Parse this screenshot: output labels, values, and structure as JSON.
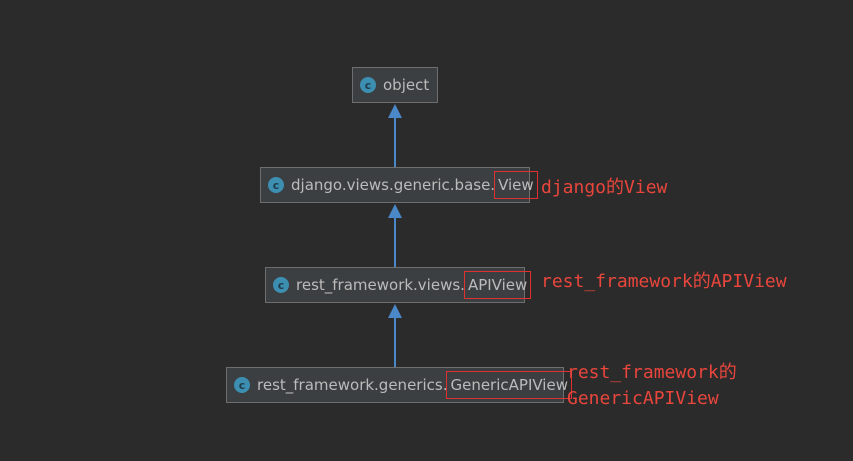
{
  "nodes": [
    {
      "prefix": "object",
      "highlight": ""
    },
    {
      "prefix": "django.views.generic.base.",
      "highlight": "View"
    },
    {
      "prefix": "rest_framework.views.",
      "highlight": "APIView"
    },
    {
      "prefix": "rest_framework.generics.",
      "highlight": "GenericAPIView"
    }
  ],
  "class_icon_glyph": "c",
  "annotations": [
    {
      "lines": [
        "django的View"
      ]
    },
    {
      "lines": [
        "rest_framework的APIView"
      ]
    },
    {
      "lines": [
        "rest_framework的",
        "GenericAPIView"
      ]
    }
  ],
  "colors": {
    "background": "#2b2b2b",
    "node_fill": "#3c3f41",
    "node_text": "#bbbbbb",
    "class_icon": "#3d8fb1",
    "arrow": "#4a88c7",
    "highlight_box": "#e03030",
    "annotation_text": "#e8463c"
  }
}
